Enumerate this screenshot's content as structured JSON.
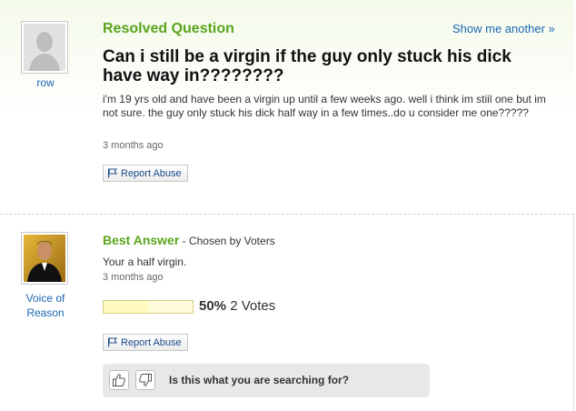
{
  "question": {
    "status_label": "Resolved Question",
    "show_another": "Show me another »",
    "asker_name": "row",
    "title": "Can i still be a virgin if the guy only stuck his dick have way in????????",
    "body": "i'm 19 yrs old and have been a virgin up until a few weeks ago. well i think im stiil one but im not sure. the guy only stuck his dick half way in a few times..do u consider me one?????",
    "time": "3 months ago",
    "report_label": "Report Abuse"
  },
  "answer": {
    "title": "Best Answer",
    "chosen_by": " - Chosen by Voters",
    "answerer_name_line1": "Voice of",
    "answerer_name_line2": "Reason",
    "text": "Your a half virgin.",
    "time": "3 months ago",
    "vote_percent": "50%",
    "vote_fraction": 0.5,
    "vote_count": " 2 Votes",
    "report_label": "Report Abuse"
  },
  "feedback": {
    "prompt": "Is this what you are searching for?"
  },
  "colors": {
    "accent_green": "#5aa51d",
    "link_blue": "#1a66b5"
  },
  "icons": [
    "default-avatar-icon",
    "user-photo-icon",
    "flag-icon",
    "thumbs-up-icon",
    "thumbs-down-icon"
  ]
}
